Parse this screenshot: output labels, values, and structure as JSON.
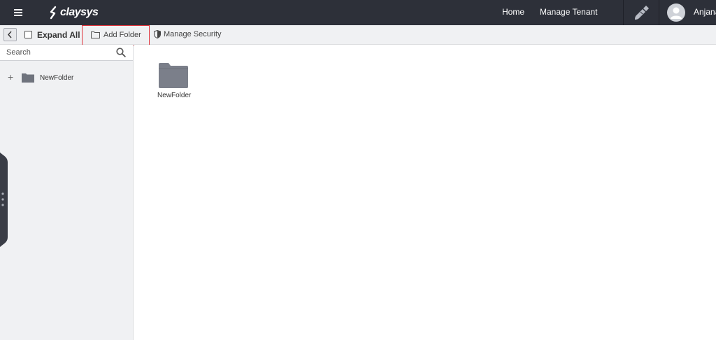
{
  "header": {
    "logo_text": "claysys",
    "nav": {
      "home": "Home",
      "manage_tenant": "Manage Tenant"
    },
    "user_name": "Anjana"
  },
  "toolbar": {
    "expand_all": "Expand All",
    "add_folder": "Add Folder",
    "manage_security": "Manage Security",
    "highlight_color": "#e0343c"
  },
  "sidebar": {
    "search_placeholder": "Search",
    "tree": [
      {
        "label": "NewFolder"
      }
    ]
  },
  "main": {
    "folders": [
      {
        "label": "NewFolder"
      }
    ]
  },
  "colors": {
    "topbar": "#2d3039",
    "folder": "#7b7f8a",
    "sidebar_bg": "#f0f1f3"
  }
}
